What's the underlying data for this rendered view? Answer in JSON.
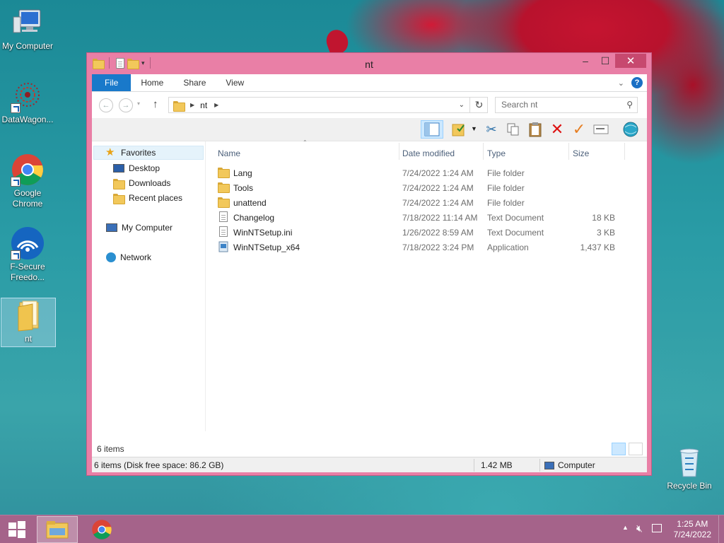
{
  "desktop": {
    "icons": [
      {
        "label": "My Computer",
        "icon": "my-computer-icon"
      },
      {
        "label": "DataWagon...",
        "icon": "datawagon-icon"
      },
      {
        "label": "Google Chrome",
        "icon": "chrome-icon"
      },
      {
        "label": "F-Secure Freedo...",
        "icon": "fsecure-icon"
      },
      {
        "label": "nt",
        "icon": "folder-icon"
      },
      {
        "label": "Recycle Bin",
        "icon": "recycle-bin-icon"
      }
    ]
  },
  "window": {
    "title": "nt",
    "controls": {
      "minimize": "–",
      "maximize": "☐",
      "close": "✕"
    },
    "ribbon_tabs": [
      "File",
      "Home",
      "Share",
      "View"
    ],
    "address": {
      "segments": [
        "nt"
      ]
    },
    "search": {
      "placeholder": "Search nt"
    },
    "nav": {
      "favorites": "Favorites",
      "desktop": "Desktop",
      "downloads": "Downloads",
      "recent": "Recent places",
      "computer": "My Computer",
      "network": "Network"
    },
    "columns": [
      "Name",
      "Date modified",
      "Type",
      "Size"
    ],
    "files": [
      {
        "name": "Lang",
        "date": "7/24/2022 1:24 AM",
        "type": "File folder",
        "size": "",
        "kind": "folder"
      },
      {
        "name": "Tools",
        "date": "7/24/2022 1:24 AM",
        "type": "File folder",
        "size": "",
        "kind": "folder"
      },
      {
        "name": "unattend",
        "date": "7/24/2022 1:24 AM",
        "type": "File folder",
        "size": "",
        "kind": "folder"
      },
      {
        "name": "Changelog",
        "date": "7/18/2022 11:14 AM",
        "type": "Text Document",
        "size": "18 KB",
        "kind": "text"
      },
      {
        "name": "WinNTSetup.ini",
        "date": "1/26/2022 8:59 AM",
        "type": "Text Document",
        "size": "3 KB",
        "kind": "text"
      },
      {
        "name": "WinNTSetup_x64",
        "date": "7/18/2022 3:24 PM",
        "type": "Application",
        "size": "1,437 KB",
        "kind": "app"
      }
    ],
    "item_count": "6 items",
    "status": {
      "summary": "6 items (Disk free space: 86.2 GB)",
      "size": "1.42 MB",
      "location": "Computer"
    }
  },
  "taskbar": {
    "time": "1:25 AM",
    "date": "7/24/2022"
  },
  "colors": {
    "window_frame": "#e97fa6",
    "file_tab": "#1979ca",
    "close_button": "#c7496f",
    "taskbar": "#a5638a"
  }
}
